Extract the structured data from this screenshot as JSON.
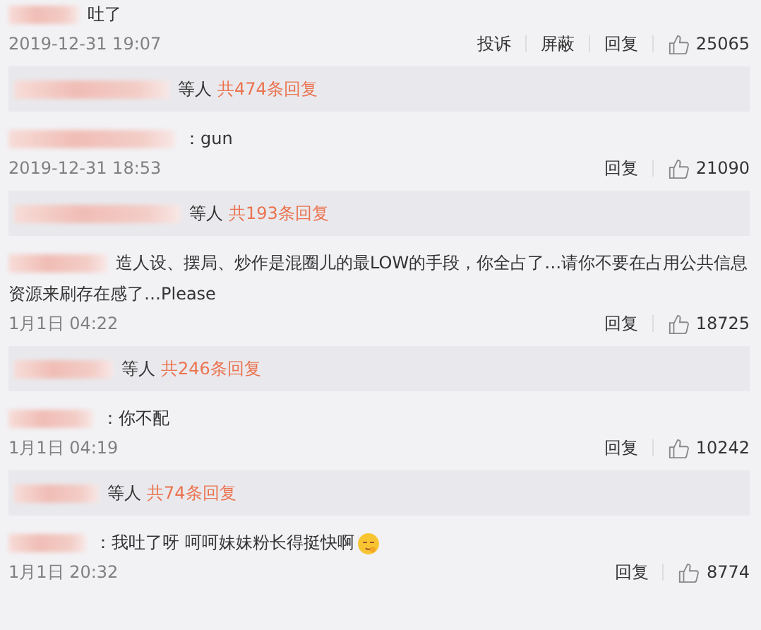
{
  "comments": [
    {
      "text": "吐了",
      "time": "2019-12-31 19:07",
      "actions": [
        "投诉",
        "屏蔽",
        "回复"
      ],
      "likes": "25065",
      "emoji": false,
      "replies": {
        "suffix": "等人",
        "count": "共474条回复"
      }
    },
    {
      "text": "：gun",
      "time": "2019-12-31 18:53",
      "actions": [
        "回复"
      ],
      "likes": "21090",
      "emoji": false,
      "replies": {
        "suffix": "等人",
        "count": "共193条回复"
      }
    },
    {
      "text": "造人设、摆局、炒作是混圈儿的最LOW的手段，你全占了…请你不要在占用公共信息资源来刷存在感了…Please",
      "time": "1月1日 04:22",
      "actions": [
        "回复"
      ],
      "likes": "18725",
      "emoji": false,
      "replies": {
        "suffix": "等人",
        "count": "共246条回复"
      }
    },
    {
      "text": "：你不配",
      "time": "1月1日 04:19",
      "actions": [
        "回复"
      ],
      "likes": "10242",
      "emoji": false,
      "replies": {
        "suffix": "等人",
        "count": "共74条回复"
      }
    },
    {
      "text": "：我吐了呀  呵呵妹妹粉长得挺快啊",
      "time": "1月1日 20:32",
      "actions": [
        "回复"
      ],
      "likes": "8774",
      "emoji": true
    }
  ]
}
